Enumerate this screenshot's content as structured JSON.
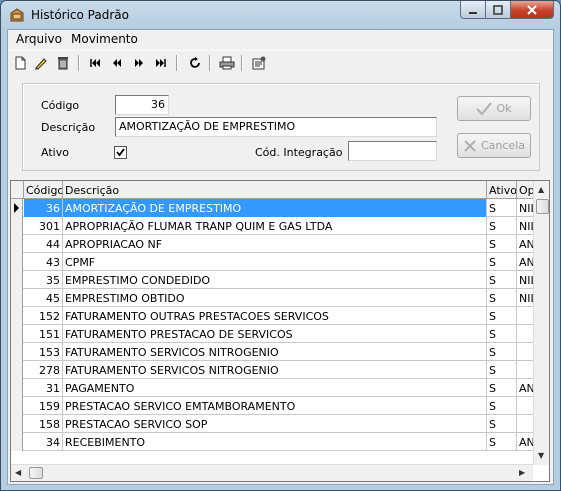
{
  "window": {
    "title": "Histórico Padrão"
  },
  "menu": {
    "items": [
      "Arquivo",
      "Movimento"
    ]
  },
  "form": {
    "codigo_label": "Código",
    "codigo_value": "36",
    "descricao_label": "Descrição",
    "descricao_value": "AMORTIZAÇÃO DE EMPRESTIMO",
    "ativo_label": "Ativo",
    "ativo_checked": true,
    "integracao_label": "Cód. Integração",
    "integracao_value": "",
    "ok_label": "Ok",
    "cancel_label": "Cancela"
  },
  "grid": {
    "columns": [
      "Código",
      "Descrição",
      "Ativo",
      "Op"
    ],
    "rows": [
      {
        "codigo": "36",
        "descricao": "AMORTIZAÇÃO DE EMPRESTIMO",
        "ativo": "S",
        "op": "NIL"
      },
      {
        "codigo": "301",
        "descricao": "APROPRIAÇÃO FLUMAR TRANP QUIM E GAS LTDA",
        "ativo": "S",
        "op": "NIL"
      },
      {
        "codigo": "44",
        "descricao": "APROPRIACAO NF",
        "ativo": "S",
        "op": "AN"
      },
      {
        "codigo": "43",
        "descricao": "CPMF",
        "ativo": "S",
        "op": "AN"
      },
      {
        "codigo": "35",
        "descricao": "EMPRESTIMO CONDEDIDO",
        "ativo": "S",
        "op": "NIL"
      },
      {
        "codigo": "45",
        "descricao": "EMPRESTIMO OBTIDO",
        "ativo": "S",
        "op": "NIL"
      },
      {
        "codigo": "152",
        "descricao": "FATURAMENTO OUTRAS PRESTACOES SERVICOS",
        "ativo": "S",
        "op": ""
      },
      {
        "codigo": "151",
        "descricao": "FATURAMENTO PRESTACAO DE SERVICOS",
        "ativo": "S",
        "op": ""
      },
      {
        "codigo": "153",
        "descricao": "FATURAMENTO SERVICOS NITROGENIO",
        "ativo": "S",
        "op": ""
      },
      {
        "codigo": "278",
        "descricao": "FATURAMENTO SERVICOS NITROGENIO",
        "ativo": "S",
        "op": ""
      },
      {
        "codigo": "31",
        "descricao": "PAGAMENTO",
        "ativo": "S",
        "op": "AN"
      },
      {
        "codigo": "159",
        "descricao": "PRESTACAO SERVICO EMTAMBORAMENTO",
        "ativo": "S",
        "op": ""
      },
      {
        "codigo": "158",
        "descricao": "PRESTACAO SERVICO SOP",
        "ativo": "S",
        "op": ""
      },
      {
        "codigo": "34",
        "descricao": "RECEBIMENTO",
        "ativo": "S",
        "op": "AN"
      }
    ]
  },
  "icons": {
    "toolbar": [
      "new-icon",
      "edit-icon",
      "delete-icon",
      "first-record-icon",
      "previous-record-icon",
      "next-record-icon",
      "last-record-icon",
      "refresh-icon",
      "print-icon",
      "properties-icon"
    ]
  },
  "colors": {
    "selection": "#3399ff",
    "close_button": "#c7432a"
  }
}
